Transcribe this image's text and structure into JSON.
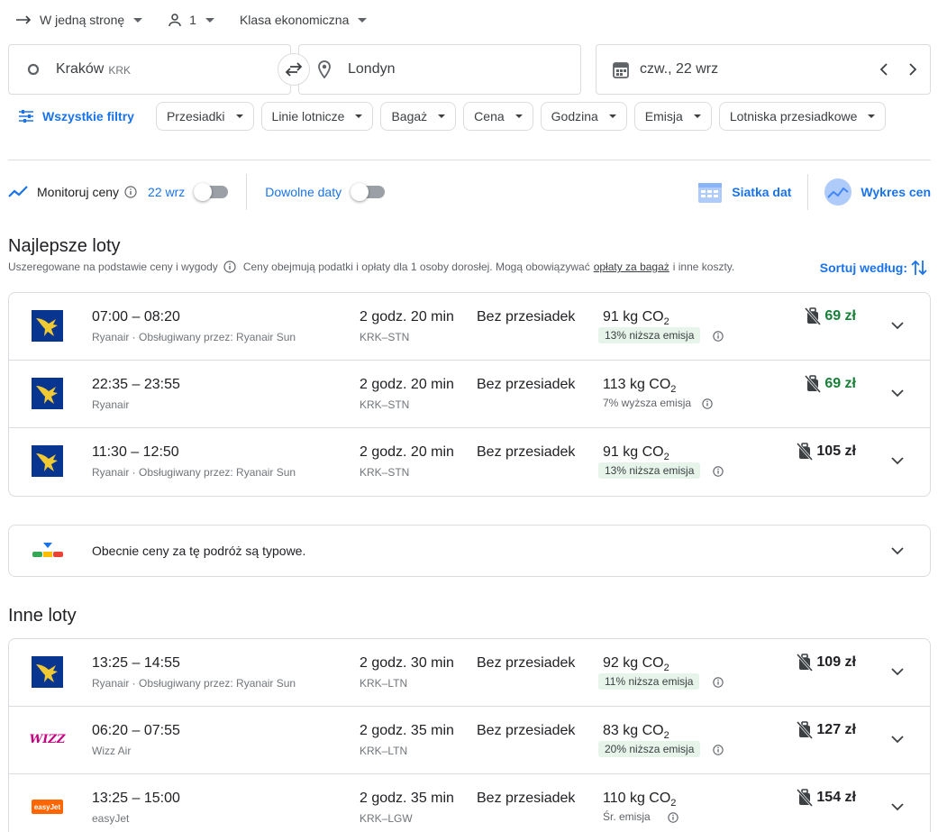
{
  "topbar": {
    "trip_type": "W jedną stronę",
    "passengers": "1",
    "cabin": "Klasa ekonomiczna"
  },
  "search": {
    "origin": "Kraków",
    "origin_code": "KRK",
    "destination": "Londyn",
    "date": "czw., 22 wrz"
  },
  "filters": {
    "all": "Wszystkie filtry",
    "chips": [
      "Przesiadki",
      "Linie lotnicze",
      "Bagaż",
      "Cena",
      "Godzina",
      "Emisja",
      "Lotniska przesiadkowe"
    ]
  },
  "tools": {
    "monitor": "Monitoruj ceny",
    "monitor_date": "22 wrz",
    "any_dates": "Dowolne daty",
    "date_grid": "Siatka dat",
    "price_graph": "Wykres cen"
  },
  "best": {
    "title": "Najlepsze loty",
    "subtitle_rank": "Uszeregowane na podstawie ceny i wygody",
    "subtitle_prices_a": "Ceny obejmują podatki i opłaty dla 1 osoby dorosłej. Mogą obowiązywać",
    "subtitle_link": "opłaty za bagaż",
    "subtitle_prices_b": "i inne koszty.",
    "sort": "Sortuj według:"
  },
  "flights_best": [
    {
      "times": "07:00 – 08:20",
      "airline": "Ryanair · Obsługiwany przez: Ryanair Sun",
      "duration": "2 godz. 20 min",
      "route": "KRK–STN",
      "stops": "Bez przesiadek",
      "co2_value": "91 kg CO",
      "co2_sub": "2",
      "emission": "13% niższa emisja",
      "emission_low": true,
      "price": "69 zł",
      "cheap": true,
      "logo": "ryanair"
    },
    {
      "times": "22:35 – 23:55",
      "airline": "Ryanair",
      "duration": "2 godz. 20 min",
      "route": "KRK–STN",
      "stops": "Bez przesiadek",
      "co2_value": "113 kg CO",
      "co2_sub": "2",
      "emission": "7% wyższa emisja",
      "emission_low": false,
      "price": "69 zł",
      "cheap": true,
      "logo": "ryanair"
    },
    {
      "times": "11:30 – 12:50",
      "airline": "Ryanair · Obsługiwany przez: Ryanair Sun",
      "duration": "2 godz. 20 min",
      "route": "KRK–STN",
      "stops": "Bez przesiadek",
      "co2_value": "91 kg CO",
      "co2_sub": "2",
      "emission": "13% niższa emisja",
      "emission_low": true,
      "price": "105 zł",
      "cheap": false,
      "logo": "ryanair"
    }
  ],
  "insight": {
    "text": "Obecnie ceny za tę podróż są typowe."
  },
  "other": {
    "title": "Inne loty"
  },
  "flights_other": [
    {
      "times": "13:25 – 14:55",
      "airline": "Ryanair · Obsługiwany przez: Ryanair Sun",
      "duration": "2 godz. 30 min",
      "route": "KRK–LTN",
      "stops": "Bez przesiadek",
      "co2_value": "92 kg CO",
      "co2_sub": "2",
      "emission": "11% niższa emisja",
      "emission_low": true,
      "price": "109 zł",
      "cheap": false,
      "logo": "ryanair"
    },
    {
      "times": "06:20 – 07:55",
      "airline": "Wizz Air",
      "duration": "2 godz. 35 min",
      "route": "KRK–LTN",
      "stops": "Bez przesiadek",
      "co2_value": "83 kg CO",
      "co2_sub": "2",
      "emission": "20% niższa emisja",
      "emission_low": true,
      "price": "127 zł",
      "cheap": false,
      "logo": "wizz",
      "logo_text": "WIZZ"
    },
    {
      "times": "13:25 – 15:00",
      "airline": "easyJet",
      "duration": "2 godz. 35 min",
      "route": "KRK–LGW",
      "stops": "Bez przesiadek",
      "co2_value": "110 kg CO",
      "co2_sub": "2",
      "emission": "Śr. emisja",
      "emission_low": false,
      "price": "154 zł",
      "cheap": false,
      "logo": "easyjet",
      "logo_text": "easyJet"
    }
  ]
}
